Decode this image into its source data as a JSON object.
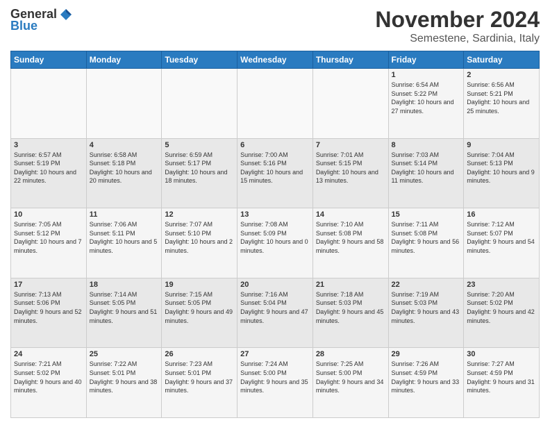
{
  "logo": {
    "general": "General",
    "blue": "Blue"
  },
  "header": {
    "month_year": "November 2024",
    "location": "Semestene, Sardinia, Italy"
  },
  "days_of_week": [
    "Sunday",
    "Monday",
    "Tuesday",
    "Wednesday",
    "Thursday",
    "Friday",
    "Saturday"
  ],
  "weeks": [
    [
      {
        "day": "",
        "info": ""
      },
      {
        "day": "",
        "info": ""
      },
      {
        "day": "",
        "info": ""
      },
      {
        "day": "",
        "info": ""
      },
      {
        "day": "",
        "info": ""
      },
      {
        "day": "1",
        "info": "Sunrise: 6:54 AM\nSunset: 5:22 PM\nDaylight: 10 hours and 27 minutes."
      },
      {
        "day": "2",
        "info": "Sunrise: 6:56 AM\nSunset: 5:21 PM\nDaylight: 10 hours and 25 minutes."
      }
    ],
    [
      {
        "day": "3",
        "info": "Sunrise: 6:57 AM\nSunset: 5:19 PM\nDaylight: 10 hours and 22 minutes."
      },
      {
        "day": "4",
        "info": "Sunrise: 6:58 AM\nSunset: 5:18 PM\nDaylight: 10 hours and 20 minutes."
      },
      {
        "day": "5",
        "info": "Sunrise: 6:59 AM\nSunset: 5:17 PM\nDaylight: 10 hours and 18 minutes."
      },
      {
        "day": "6",
        "info": "Sunrise: 7:00 AM\nSunset: 5:16 PM\nDaylight: 10 hours and 15 minutes."
      },
      {
        "day": "7",
        "info": "Sunrise: 7:01 AM\nSunset: 5:15 PM\nDaylight: 10 hours and 13 minutes."
      },
      {
        "day": "8",
        "info": "Sunrise: 7:03 AM\nSunset: 5:14 PM\nDaylight: 10 hours and 11 minutes."
      },
      {
        "day": "9",
        "info": "Sunrise: 7:04 AM\nSunset: 5:13 PM\nDaylight: 10 hours and 9 minutes."
      }
    ],
    [
      {
        "day": "10",
        "info": "Sunrise: 7:05 AM\nSunset: 5:12 PM\nDaylight: 10 hours and 7 minutes."
      },
      {
        "day": "11",
        "info": "Sunrise: 7:06 AM\nSunset: 5:11 PM\nDaylight: 10 hours and 5 minutes."
      },
      {
        "day": "12",
        "info": "Sunrise: 7:07 AM\nSunset: 5:10 PM\nDaylight: 10 hours and 2 minutes."
      },
      {
        "day": "13",
        "info": "Sunrise: 7:08 AM\nSunset: 5:09 PM\nDaylight: 10 hours and 0 minutes."
      },
      {
        "day": "14",
        "info": "Sunrise: 7:10 AM\nSunset: 5:08 PM\nDaylight: 9 hours and 58 minutes."
      },
      {
        "day": "15",
        "info": "Sunrise: 7:11 AM\nSunset: 5:08 PM\nDaylight: 9 hours and 56 minutes."
      },
      {
        "day": "16",
        "info": "Sunrise: 7:12 AM\nSunset: 5:07 PM\nDaylight: 9 hours and 54 minutes."
      }
    ],
    [
      {
        "day": "17",
        "info": "Sunrise: 7:13 AM\nSunset: 5:06 PM\nDaylight: 9 hours and 52 minutes."
      },
      {
        "day": "18",
        "info": "Sunrise: 7:14 AM\nSunset: 5:05 PM\nDaylight: 9 hours and 51 minutes."
      },
      {
        "day": "19",
        "info": "Sunrise: 7:15 AM\nSunset: 5:05 PM\nDaylight: 9 hours and 49 minutes."
      },
      {
        "day": "20",
        "info": "Sunrise: 7:16 AM\nSunset: 5:04 PM\nDaylight: 9 hours and 47 minutes."
      },
      {
        "day": "21",
        "info": "Sunrise: 7:18 AM\nSunset: 5:03 PM\nDaylight: 9 hours and 45 minutes."
      },
      {
        "day": "22",
        "info": "Sunrise: 7:19 AM\nSunset: 5:03 PM\nDaylight: 9 hours and 43 minutes."
      },
      {
        "day": "23",
        "info": "Sunrise: 7:20 AM\nSunset: 5:02 PM\nDaylight: 9 hours and 42 minutes."
      }
    ],
    [
      {
        "day": "24",
        "info": "Sunrise: 7:21 AM\nSunset: 5:02 PM\nDaylight: 9 hours and 40 minutes."
      },
      {
        "day": "25",
        "info": "Sunrise: 7:22 AM\nSunset: 5:01 PM\nDaylight: 9 hours and 38 minutes."
      },
      {
        "day": "26",
        "info": "Sunrise: 7:23 AM\nSunset: 5:01 PM\nDaylight: 9 hours and 37 minutes."
      },
      {
        "day": "27",
        "info": "Sunrise: 7:24 AM\nSunset: 5:00 PM\nDaylight: 9 hours and 35 minutes."
      },
      {
        "day": "28",
        "info": "Sunrise: 7:25 AM\nSunset: 5:00 PM\nDaylight: 9 hours and 34 minutes."
      },
      {
        "day": "29",
        "info": "Sunrise: 7:26 AM\nSunset: 4:59 PM\nDaylight: 9 hours and 33 minutes."
      },
      {
        "day": "30",
        "info": "Sunrise: 7:27 AM\nSunset: 4:59 PM\nDaylight: 9 hours and 31 minutes."
      }
    ]
  ]
}
